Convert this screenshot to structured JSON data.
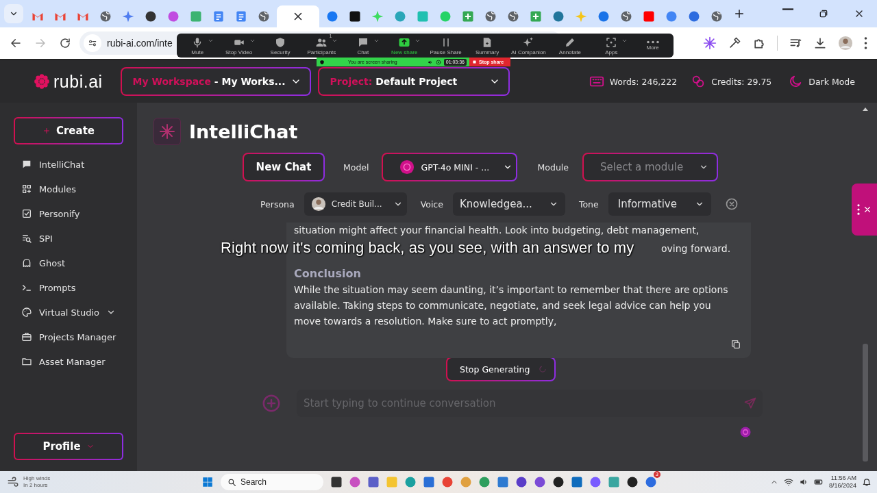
{
  "browser": {
    "tabs": [
      {
        "kind": "mail",
        "color": "#ea4335",
        "selected": false
      },
      {
        "kind": "mail",
        "color": "#ea4335",
        "selected": false
      },
      {
        "kind": "mail",
        "color": "#ea4335",
        "selected": false
      },
      {
        "kind": "globe",
        "color": "#5f6368",
        "selected": false
      },
      {
        "kind": "sparkle",
        "color": "#4f7df0",
        "selected": false
      },
      {
        "kind": "circle",
        "color": "#333333",
        "selected": false
      },
      {
        "kind": "circle",
        "color": "#c04ce0",
        "selected": false
      },
      {
        "kind": "square",
        "color": "#3cb371",
        "selected": false
      },
      {
        "kind": "doc",
        "color": "#4285f4",
        "selected": false
      },
      {
        "kind": "doc",
        "color": "#4285f4",
        "selected": false
      },
      {
        "kind": "globe",
        "color": "#5f6368",
        "selected": false
      },
      {
        "kind": "blank",
        "selected": true
      },
      {
        "kind": "circle",
        "color": "#1877f2",
        "selected": false
      },
      {
        "kind": "square",
        "color": "#111111",
        "selected": false
      },
      {
        "kind": "sparkle",
        "color": "#3ddc60",
        "selected": false
      },
      {
        "kind": "circle",
        "color": "#2aa6b8",
        "selected": false
      },
      {
        "kind": "square",
        "color": "#20c0b0",
        "selected": false
      },
      {
        "kind": "circle",
        "color": "#25d366",
        "selected": false
      },
      {
        "kind": "plus",
        "color": "#34a853",
        "selected": false
      },
      {
        "kind": "globe",
        "color": "#5f6368",
        "selected": false
      },
      {
        "kind": "globe",
        "color": "#5f6368",
        "selected": false
      },
      {
        "kind": "plus",
        "color": "#34a853",
        "selected": false
      },
      {
        "kind": "circle",
        "color": "#21759b",
        "selected": false
      },
      {
        "kind": "sparkle",
        "color": "#f5c518",
        "selected": false
      },
      {
        "kind": "circle",
        "color": "#1a73e8",
        "selected": false
      },
      {
        "kind": "globe",
        "color": "#5f6368",
        "selected": false
      },
      {
        "kind": "square",
        "color": "#ff0000",
        "selected": false
      },
      {
        "kind": "circle",
        "color": "#4285f4",
        "selected": false
      },
      {
        "kind": "circle",
        "color": "#2d6cdf",
        "selected": false
      },
      {
        "kind": "globe",
        "color": "#5f6368",
        "selected": false
      }
    ],
    "address": "rubi-ai.com/inte"
  },
  "zoom_toolbar": {
    "items": [
      {
        "kind": "mic",
        "label": "Mute",
        "caret": true
      },
      {
        "kind": "video",
        "label": "Stop Video",
        "caret": true
      },
      {
        "kind": "shield",
        "label": "Security",
        "caret": false
      },
      {
        "kind": "people",
        "label": "Participants",
        "caret": true,
        "badge": "1"
      },
      {
        "kind": "chat",
        "label": "Chat",
        "caret": true
      },
      {
        "kind": "share",
        "label": "New share",
        "caret": true
      },
      {
        "kind": "pause",
        "label": "Pause Share",
        "caret": false
      },
      {
        "kind": "doc",
        "label": "Summary",
        "caret": false
      },
      {
        "kind": "sparkle",
        "label": "AI Companion",
        "caret": false
      },
      {
        "kind": "pencil",
        "label": "Annotate",
        "caret": false
      },
      {
        "kind": "apps",
        "label": "Apps",
        "caret": true
      },
      {
        "kind": "more",
        "label": "More",
        "caret": false
      }
    ],
    "banner": {
      "status": "You are screen sharing",
      "timer": "01:03:36",
      "stop": "Stop share"
    }
  },
  "header": {
    "logo": "rubi.ai",
    "workspace": {
      "label": "My Workspace",
      "value": "- My Works..."
    },
    "project": {
      "label": "Project:",
      "value": "Default Project"
    },
    "words": "Words: 246,222",
    "credits": "Credits: 29.75",
    "theme": "Dark Mode"
  },
  "sidebar": {
    "create": "Create",
    "items": [
      {
        "kind": "chat",
        "label": "IntelliChat",
        "expandable": false
      },
      {
        "kind": "grid",
        "label": "Modules",
        "expandable": false
      },
      {
        "kind": "check",
        "label": "Personify",
        "expandable": false
      },
      {
        "kind": "spi",
        "label": "SPI",
        "expandable": false
      },
      {
        "kind": "ghost",
        "label": "Ghost",
        "expandable": false
      },
      {
        "kind": "prompt",
        "label": "Prompts",
        "expandable": false
      },
      {
        "kind": "palette",
        "label": "Virtual Studio",
        "expandable": true
      },
      {
        "kind": "briefcase",
        "label": "Projects Manager",
        "expandable": false
      },
      {
        "kind": "folder",
        "label": "Asset Manager",
        "expandable": false
      }
    ],
    "profile": "Profile"
  },
  "chat": {
    "title": "IntelliChat",
    "new_chat": "New Chat",
    "model": {
      "label": "Model",
      "value": "GPT-4o MINI - ..."
    },
    "module": {
      "label": "Module",
      "placeholder": "Select a module"
    },
    "persona": {
      "label": "Persona",
      "value": "Credit Buil..."
    },
    "voice": {
      "label": "Voice",
      "value": "Knowledgea..."
    },
    "tone": {
      "label": "Tone",
      "value": "Informative"
    },
    "message": {
      "line": "situation might affect your financial health. Look into budgeting, debt management,",
      "tail": "oving forward.",
      "heading": "Conclusion",
      "conclusion": "While the situation may seem daunting, it’s important to remember that there are options available. Taking steps to communicate, negotiate, and seek legal advice can help you move towards a resolution. Make sure to act promptly,"
    },
    "stop": "Stop Generating",
    "input": {
      "placeholder": "Start typing to continue conversation"
    }
  },
  "caption": "Right now it's coming back, as you see, with an answer to my",
  "taskbar": {
    "weather": {
      "title": "High winds",
      "subtitle": "In 2 hours"
    },
    "search": "Search",
    "apps": [
      {
        "kind": "square",
        "color": "#333333"
      },
      {
        "kind": "circle",
        "color": "#c850c0"
      },
      {
        "kind": "square",
        "color": "#5b5fc7"
      },
      {
        "kind": "square",
        "color": "#f4c430"
      },
      {
        "kind": "circle",
        "color": "#1aa0a0"
      },
      {
        "kind": "square",
        "color": "#2a6fd6"
      },
      {
        "kind": "circle",
        "color": "#e84335"
      },
      {
        "kind": "circle",
        "color": "#e0a040"
      },
      {
        "kind": "circle",
        "color": "#2e9e5e"
      },
      {
        "kind": "square",
        "color": "#2e7ad1"
      },
      {
        "kind": "circle",
        "color": "#5a3dc8"
      },
      {
        "kind": "circle",
        "color": "#7b4bd6"
      },
      {
        "kind": "circle",
        "color": "#222222"
      },
      {
        "kind": "square",
        "color": "#0f6cbd"
      },
      {
        "kind": "circle",
        "color": "#7a5cff"
      },
      {
        "kind": "square",
        "color": "#3aa6a0"
      },
      {
        "kind": "circle",
        "color": "#222222"
      },
      {
        "kind": "circle",
        "color": "#2d6cdf",
        "badge": "3"
      }
    ],
    "time": "11:56 AM",
    "date": "8/16/2024"
  }
}
